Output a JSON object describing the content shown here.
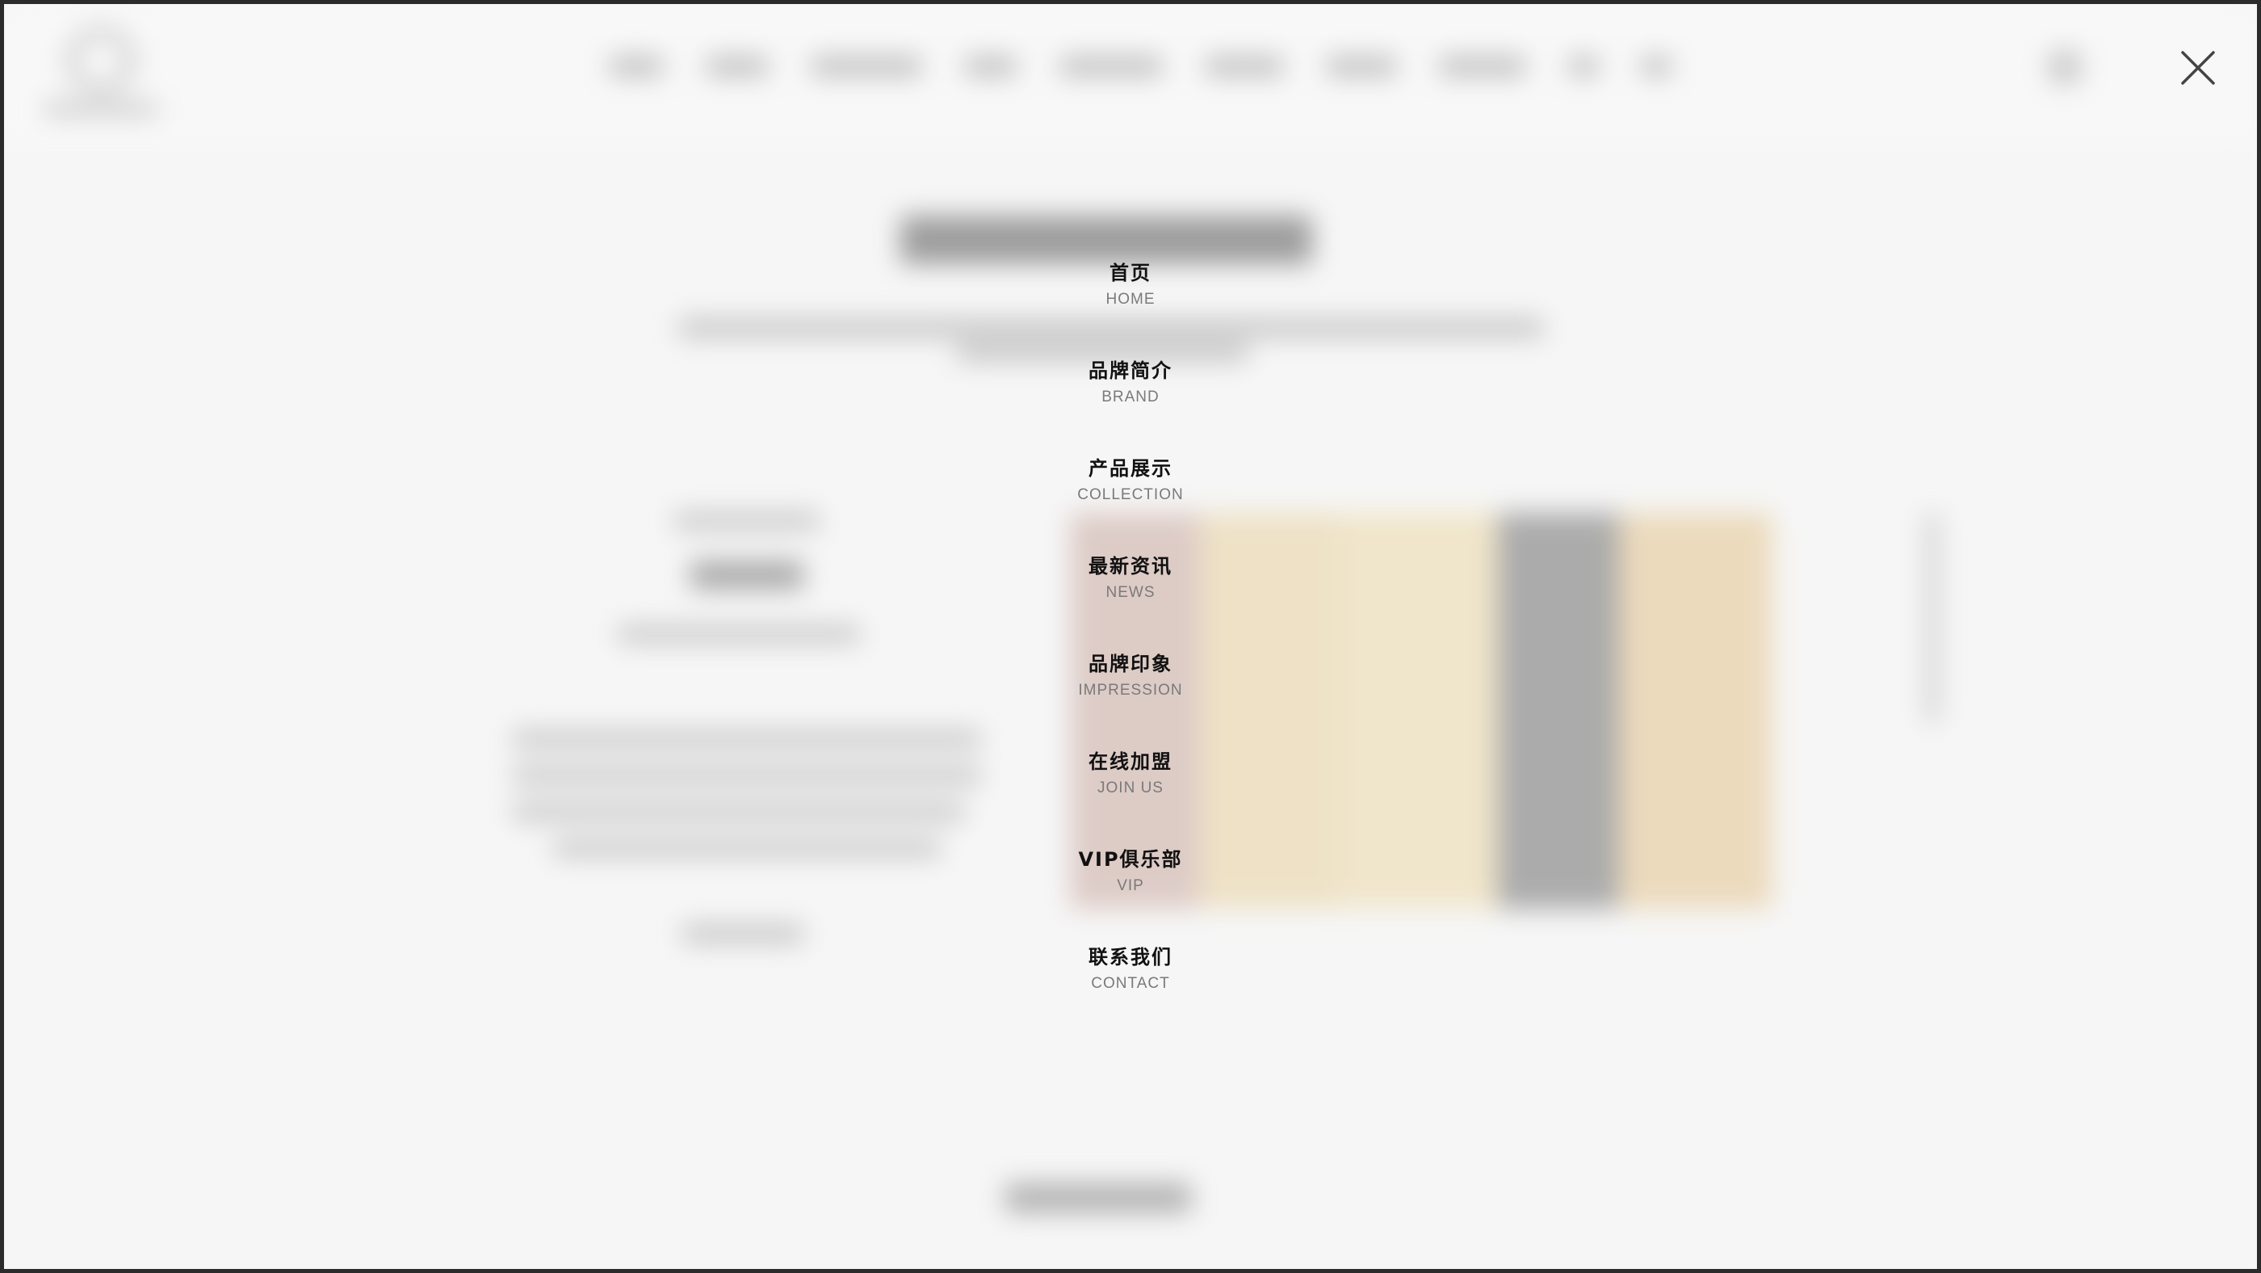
{
  "menu": {
    "items": [
      {
        "cn": "首页",
        "en": "HOME"
      },
      {
        "cn": "品牌简介",
        "en": "BRAND"
      },
      {
        "cn": "产品展示",
        "en": "COLLECTION"
      },
      {
        "cn": "最新资讯",
        "en": "NEWS"
      },
      {
        "cn": "品牌印象",
        "en": "IMPRESSION"
      },
      {
        "cn": "在线加盟",
        "en": "JOIN US"
      },
      {
        "cn": "VIP俱乐部",
        "en": "VIP"
      },
      {
        "cn": "联系我们",
        "en": "CONTACT"
      }
    ]
  },
  "overlay": {
    "close_icon": "close-icon"
  },
  "colors": {
    "menu_text": "#111111",
    "menu_subtext": "#7a7a7a",
    "overlay_bg": "#f6f6f6",
    "window_border": "#2b2b2b"
  }
}
